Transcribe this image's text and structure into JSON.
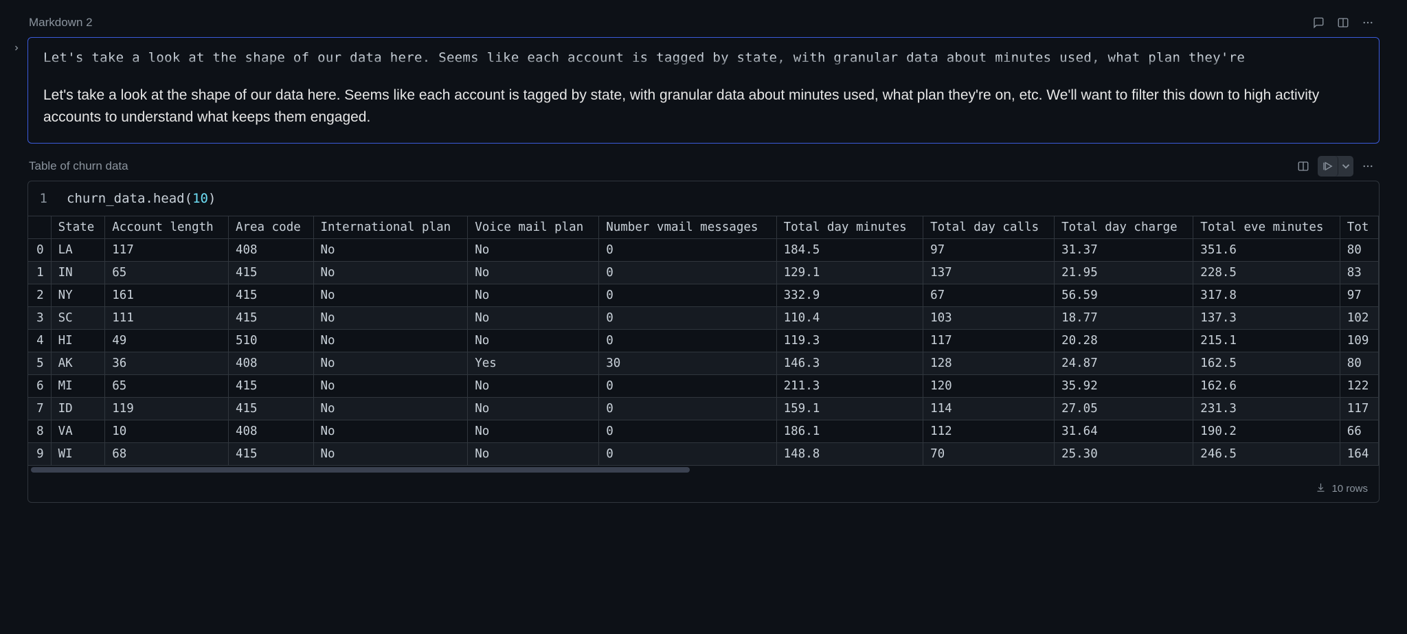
{
  "markdownCell": {
    "title": "Markdown 2",
    "raw": "Let's take a look at the shape of our data here. Seems like each account is tagged by state, with granular data about minutes used, what plan they're",
    "rendered": "Let's take a look at the shape of our data here. Seems like each account is tagged by state, with granular data about minutes used, what plan they're on, etc. We'll want to filter this down to high activity accounts to understand what keeps them engaged."
  },
  "codeCell": {
    "title": "Table of churn data",
    "lineNumber": "1",
    "code": {
      "obj": "churn_data",
      "dot": ".",
      "method": "head",
      "open": "(",
      "arg": "10",
      "close": ")"
    },
    "footerRows": "10 rows",
    "table": {
      "columns": [
        "State",
        "Account length",
        "Area code",
        "International plan",
        "Voice mail plan",
        "Number vmail messages",
        "Total day minutes",
        "Total day calls",
        "Total day charge",
        "Total eve minutes",
        "Tot"
      ],
      "index": [
        "0",
        "1",
        "2",
        "3",
        "4",
        "5",
        "6",
        "7",
        "8",
        "9"
      ],
      "rows": [
        [
          "LA",
          "117",
          "408",
          "No",
          "No",
          "0",
          "184.5",
          "97",
          "31.37",
          "351.6",
          "80"
        ],
        [
          "IN",
          "65",
          "415",
          "No",
          "No",
          "0",
          "129.1",
          "137",
          "21.95",
          "228.5",
          "83"
        ],
        [
          "NY",
          "161",
          "415",
          "No",
          "No",
          "0",
          "332.9",
          "67",
          "56.59",
          "317.8",
          "97"
        ],
        [
          "SC",
          "111",
          "415",
          "No",
          "No",
          "0",
          "110.4",
          "103",
          "18.77",
          "137.3",
          "102"
        ],
        [
          "HI",
          "49",
          "510",
          "No",
          "No",
          "0",
          "119.3",
          "117",
          "20.28",
          "215.1",
          "109"
        ],
        [
          "AK",
          "36",
          "408",
          "No",
          "Yes",
          "30",
          "146.3",
          "128",
          "24.87",
          "162.5",
          "80"
        ],
        [
          "MI",
          "65",
          "415",
          "No",
          "No",
          "0",
          "211.3",
          "120",
          "35.92",
          "162.6",
          "122"
        ],
        [
          "ID",
          "119",
          "415",
          "No",
          "No",
          "0",
          "159.1",
          "114",
          "27.05",
          "231.3",
          "117"
        ],
        [
          "VA",
          "10",
          "408",
          "No",
          "No",
          "0",
          "186.1",
          "112",
          "31.64",
          "190.2",
          "66"
        ],
        [
          "WI",
          "68",
          "415",
          "No",
          "No",
          "0",
          "148.8",
          "70",
          "25.30",
          "246.5",
          "164"
        ]
      ]
    }
  },
  "chart_data": {
    "type": "table",
    "title": "Table of churn data",
    "columns": [
      "State",
      "Account length",
      "Area code",
      "International plan",
      "Voice mail plan",
      "Number vmail messages",
      "Total day minutes",
      "Total day calls",
      "Total day charge",
      "Total eve minutes"
    ],
    "rows": [
      {
        "index": 0,
        "State": "LA",
        "Account length": 117,
        "Area code": 408,
        "International plan": "No",
        "Voice mail plan": "No",
        "Number vmail messages": 0,
        "Total day minutes": 184.5,
        "Total day calls": 97,
        "Total day charge": 31.37,
        "Total eve minutes": 351.6
      },
      {
        "index": 1,
        "State": "IN",
        "Account length": 65,
        "Area code": 415,
        "International plan": "No",
        "Voice mail plan": "No",
        "Number vmail messages": 0,
        "Total day minutes": 129.1,
        "Total day calls": 137,
        "Total day charge": 21.95,
        "Total eve minutes": 228.5
      },
      {
        "index": 2,
        "State": "NY",
        "Account length": 161,
        "Area code": 415,
        "International plan": "No",
        "Voice mail plan": "No",
        "Number vmail messages": 0,
        "Total day minutes": 332.9,
        "Total day calls": 67,
        "Total day charge": 56.59,
        "Total eve minutes": 317.8
      },
      {
        "index": 3,
        "State": "SC",
        "Account length": 111,
        "Area code": 415,
        "International plan": "No",
        "Voice mail plan": "No",
        "Number vmail messages": 0,
        "Total day minutes": 110.4,
        "Total day calls": 103,
        "Total day charge": 18.77,
        "Total eve minutes": 137.3
      },
      {
        "index": 4,
        "State": "HI",
        "Account length": 49,
        "Area code": 510,
        "International plan": "No",
        "Voice mail plan": "No",
        "Number vmail messages": 0,
        "Total day minutes": 119.3,
        "Total day calls": 117,
        "Total day charge": 20.28,
        "Total eve minutes": 215.1
      },
      {
        "index": 5,
        "State": "AK",
        "Account length": 36,
        "Area code": 408,
        "International plan": "No",
        "Voice mail plan": "Yes",
        "Number vmail messages": 30,
        "Total day minutes": 146.3,
        "Total day calls": 128,
        "Total day charge": 24.87,
        "Total eve minutes": 162.5
      },
      {
        "index": 6,
        "State": "MI",
        "Account length": 65,
        "Area code": 415,
        "International plan": "No",
        "Voice mail plan": "No",
        "Number vmail messages": 0,
        "Total day minutes": 211.3,
        "Total day calls": 120,
        "Total day charge": 35.92,
        "Total eve minutes": 162.6
      },
      {
        "index": 7,
        "State": "ID",
        "Account length": 119,
        "Area code": 415,
        "International plan": "No",
        "Voice mail plan": "No",
        "Number vmail messages": 0,
        "Total day minutes": 159.1,
        "Total day calls": 114,
        "Total day charge": 27.05,
        "Total eve minutes": 231.3
      },
      {
        "index": 8,
        "State": "VA",
        "Account length": 10,
        "Area code": 408,
        "International plan": "No",
        "Voice mail plan": "No",
        "Number vmail messages": 0,
        "Total day minutes": 186.1,
        "Total day calls": 112,
        "Total day charge": 31.64,
        "Total eve minutes": 190.2
      },
      {
        "index": 9,
        "State": "WI",
        "Account length": 68,
        "Area code": 415,
        "International plan": "No",
        "Voice mail plan": "No",
        "Number vmail messages": 0,
        "Total day minutes": 148.8,
        "Total day calls": 70,
        "Total day charge": 25.3,
        "Total eve minutes": 246.5
      }
    ]
  }
}
